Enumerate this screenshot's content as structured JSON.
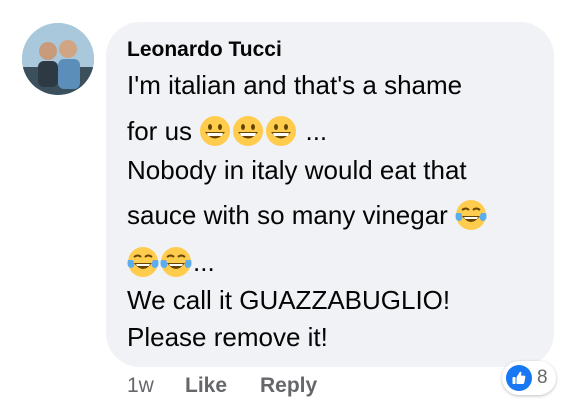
{
  "comment": {
    "author": "Leonardo Tucci",
    "lines": [
      {
        "text": "I'm italian and that's a shame",
        "emojis": []
      },
      {
        "text": "for us",
        "emojis": [
          "grinning-face",
          "grinning-face",
          "grinning-face"
        ],
        "suffix": " ..."
      },
      {
        "text": "Nobody in italy would eat that",
        "emojis": []
      },
      {
        "text": "sauce with so many vinegar",
        "emojis": [
          "tears-of-joy-face"
        ],
        "suffix": ""
      },
      {
        "text": "",
        "emojis": [
          "tears-of-joy-face",
          "tears-of-joy-face"
        ],
        "suffix": "..."
      },
      {
        "text": "We call it GUAZZABUGLIO!",
        "emojis": []
      },
      {
        "text": "Please remove it!",
        "emojis": []
      }
    ]
  },
  "footer": {
    "time": "1w",
    "like_label": "Like",
    "reply_label": "Reply"
  },
  "reactions": {
    "icon": "like-icon",
    "count": "8"
  },
  "colors": {
    "bubble": "#f0f2f5",
    "meta_text": "#65676b",
    "like_blue": "#1877f2",
    "emoji_yellow": "#ffcc4d"
  }
}
